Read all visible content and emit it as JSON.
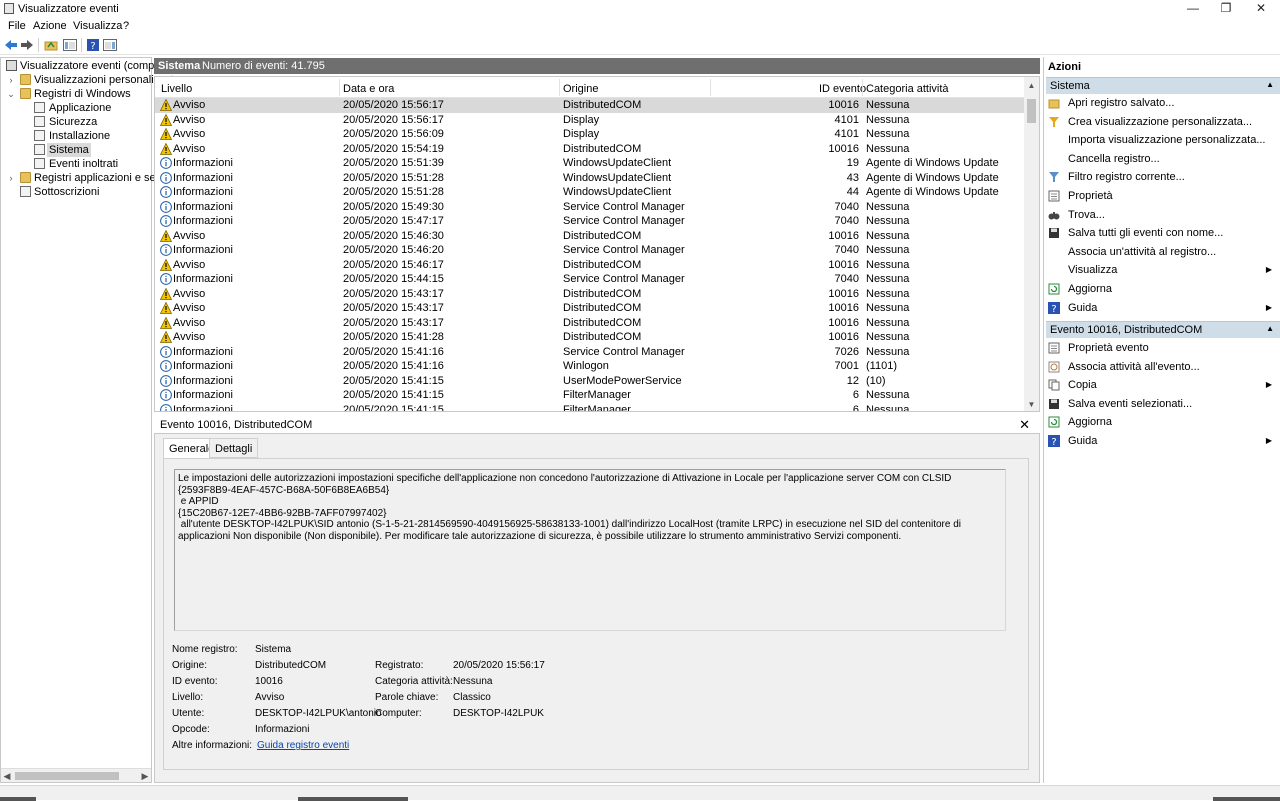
{
  "window": {
    "title": "Visualizzatore eventi",
    "minimize": "—",
    "restore": "❐",
    "close": "✕"
  },
  "menu": [
    "File",
    "Azione",
    "Visualizza",
    "?"
  ],
  "tree": {
    "root": "Visualizzatore eventi (computer",
    "custom_views": "Visualizzazioni personalizzate",
    "windows_logs": "Registri di Windows",
    "logs": [
      "Applicazione",
      "Sicurezza",
      "Installazione",
      "Sistema",
      "Eventi inoltrati"
    ],
    "app_logs": "Registri applicazioni e servizi",
    "subscriptions": "Sottoscrizioni"
  },
  "list_header": {
    "name": "Sistema",
    "count": "Numero di eventi: 41.795"
  },
  "columns": [
    "Livello",
    "Data e ora",
    "Origine",
    "ID evento",
    "Categoria attività"
  ],
  "events": [
    {
      "level": "Avviso",
      "type": "warning",
      "date": "20/05/2020 15:56:17",
      "source": "DistributedCOM",
      "id": "10016",
      "category": "Nessuna"
    },
    {
      "level": "Avviso",
      "type": "warning",
      "date": "20/05/2020 15:56:17",
      "source": "Display",
      "id": "4101",
      "category": "Nessuna"
    },
    {
      "level": "Avviso",
      "type": "warning",
      "date": "20/05/2020 15:56:09",
      "source": "Display",
      "id": "4101",
      "category": "Nessuna"
    },
    {
      "level": "Avviso",
      "type": "warning",
      "date": "20/05/2020 15:54:19",
      "source": "DistributedCOM",
      "id": "10016",
      "category": "Nessuna"
    },
    {
      "level": "Informazioni",
      "type": "info",
      "date": "20/05/2020 15:51:39",
      "source": "WindowsUpdateClient",
      "id": "19",
      "category": "Agente di Windows Update"
    },
    {
      "level": "Informazioni",
      "type": "info",
      "date": "20/05/2020 15:51:28",
      "source": "WindowsUpdateClient",
      "id": "43",
      "category": "Agente di Windows Update"
    },
    {
      "level": "Informazioni",
      "type": "info",
      "date": "20/05/2020 15:51:28",
      "source": "WindowsUpdateClient",
      "id": "44",
      "category": "Agente di Windows Update"
    },
    {
      "level": "Informazioni",
      "type": "info",
      "date": "20/05/2020 15:49:30",
      "source": "Service Control Manager",
      "id": "7040",
      "category": "Nessuna"
    },
    {
      "level": "Informazioni",
      "type": "info",
      "date": "20/05/2020 15:47:17",
      "source": "Service Control Manager",
      "id": "7040",
      "category": "Nessuna"
    },
    {
      "level": "Avviso",
      "type": "warning",
      "date": "20/05/2020 15:46:30",
      "source": "DistributedCOM",
      "id": "10016",
      "category": "Nessuna"
    },
    {
      "level": "Informazioni",
      "type": "info",
      "date": "20/05/2020 15:46:20",
      "source": "Service Control Manager",
      "id": "7040",
      "category": "Nessuna"
    },
    {
      "level": "Avviso",
      "type": "warning",
      "date": "20/05/2020 15:46:17",
      "source": "DistributedCOM",
      "id": "10016",
      "category": "Nessuna"
    },
    {
      "level": "Informazioni",
      "type": "info",
      "date": "20/05/2020 15:44:15",
      "source": "Service Control Manager",
      "id": "7040",
      "category": "Nessuna"
    },
    {
      "level": "Avviso",
      "type": "warning",
      "date": "20/05/2020 15:43:17",
      "source": "DistributedCOM",
      "id": "10016",
      "category": "Nessuna"
    },
    {
      "level": "Avviso",
      "type": "warning",
      "date": "20/05/2020 15:43:17",
      "source": "DistributedCOM",
      "id": "10016",
      "category": "Nessuna"
    },
    {
      "level": "Avviso",
      "type": "warning",
      "date": "20/05/2020 15:43:17",
      "source": "DistributedCOM",
      "id": "10016",
      "category": "Nessuna"
    },
    {
      "level": "Avviso",
      "type": "warning",
      "date": "20/05/2020 15:41:28",
      "source": "DistributedCOM",
      "id": "10016",
      "category": "Nessuna"
    },
    {
      "level": "Informazioni",
      "type": "info",
      "date": "20/05/2020 15:41:16",
      "source": "Service Control Manager",
      "id": "7026",
      "category": "Nessuna"
    },
    {
      "level": "Informazioni",
      "type": "info",
      "date": "20/05/2020 15:41:16",
      "source": "Winlogon",
      "id": "7001",
      "category": "(1101)"
    },
    {
      "level": "Informazioni",
      "type": "info",
      "date": "20/05/2020 15:41:15",
      "source": "UserModePowerService",
      "id": "12",
      "category": "(10)"
    },
    {
      "level": "Informazioni",
      "type": "info",
      "date": "20/05/2020 15:41:15",
      "source": "FilterManager",
      "id": "6",
      "category": "Nessuna"
    },
    {
      "level": "Informazioni",
      "type": "info",
      "date": "20/05/2020 15:41:15",
      "source": "FilterManager",
      "id": "6",
      "category": "Nessuna"
    }
  ],
  "detail": {
    "title": "Evento 10016, DistributedCOM",
    "close": "✕",
    "tabs": [
      "Generale",
      "Dettagli"
    ],
    "description": "Le impostazioni delle autorizzazioni impostazioni specifiche dell'applicazione non concedono l'autorizzazione di Attivazione in Locale per l'applicazione server COM con CLSID\n{2593F8B9-4EAF-457C-B68A-50F6B8EA6B54}\n e APPID\n{15C20B67-12E7-4BB6-92BB-7AFF07997402}\n all'utente DESKTOP-I42LPUK\\SID antonio (S-1-5-21-2814569590-4049156925-58638133-1001) dall'indirizzo LocalHost (tramite LRPC) in esecuzione nel SID del contenitore di applicazioni Non disponibile (Non disponibile). Per modificare tale autorizzazione di sicurezza, è possibile utilizzare lo strumento amministrativo Servizi componenti.",
    "fields": {
      "log_name_label": "Nome registro:",
      "log_name": "Sistema",
      "source_label": "Origine:",
      "source": "DistributedCOM",
      "logged_label": "Registrato:",
      "logged": "20/05/2020 15:56:17",
      "event_id_label": "ID evento:",
      "event_id": "10016",
      "task_label": "Categoria attività:",
      "task": "Nessuna",
      "level_label": "Livello:",
      "level": "Avviso",
      "keywords_label": "Parole chiave:",
      "keywords": "Classico",
      "user_label": "Utente:",
      "user": "DESKTOP-I42LPUK\\antonio",
      "computer_label": "Computer:",
      "computer": "DESKTOP-I42LPUK",
      "opcode_label": "Opcode:",
      "opcode": "Informazioni",
      "more_info_label": "Altre informazioni:",
      "more_info_link": "Guida registro eventi"
    }
  },
  "actions": {
    "title": "Azioni",
    "section1": "Sistema",
    "section1_items": [
      {
        "label": "Apri registro salvato...",
        "icon": "folder-open-icon",
        "submenu": false
      },
      {
        "label": "Crea visualizzazione personalizzata...",
        "icon": "filter-create-icon",
        "submenu": false
      },
      {
        "label": "Importa visualizzazione personalizzata...",
        "icon": "",
        "submenu": false
      },
      {
        "label": "Cancella registro...",
        "icon": "",
        "submenu": false
      },
      {
        "label": "Filtro registro corrente...",
        "icon": "filter-icon",
        "submenu": false
      },
      {
        "label": "Proprietà",
        "icon": "properties-icon",
        "submenu": false
      },
      {
        "label": "Trova...",
        "icon": "binoculars-icon",
        "submenu": false
      },
      {
        "label": "Salva tutti gli eventi con nome...",
        "icon": "save-icon",
        "submenu": false
      },
      {
        "label": "Associa un'attività al registro...",
        "icon": "",
        "submenu": false
      },
      {
        "label": "Visualizza",
        "icon": "",
        "submenu": true
      },
      {
        "label": "Aggiorna",
        "icon": "refresh-icon",
        "submenu": false
      },
      {
        "label": "Guida",
        "icon": "help-icon",
        "submenu": true
      }
    ],
    "section2": "Evento 10016, DistributedCOM",
    "section2_items": [
      {
        "label": "Proprietà evento",
        "icon": "properties-icon",
        "submenu": false
      },
      {
        "label": "Associa attività all'evento...",
        "icon": "task-icon",
        "submenu": false
      },
      {
        "label": "Copia",
        "icon": "copy-icon",
        "submenu": true
      },
      {
        "label": "Salva eventi selezionati...",
        "icon": "save-icon",
        "submenu": false
      },
      {
        "label": "Aggiorna",
        "icon": "refresh-icon",
        "submenu": false
      },
      {
        "label": "Guida",
        "icon": "help-icon",
        "submenu": true
      }
    ]
  },
  "colors": {
    "section_header": "#cfdde8",
    "list_header": "#6f6f6f",
    "selection": "#d9d9d9",
    "link": "#0645ad",
    "warning": "#f2c500",
    "info": "#1f5fa8"
  }
}
